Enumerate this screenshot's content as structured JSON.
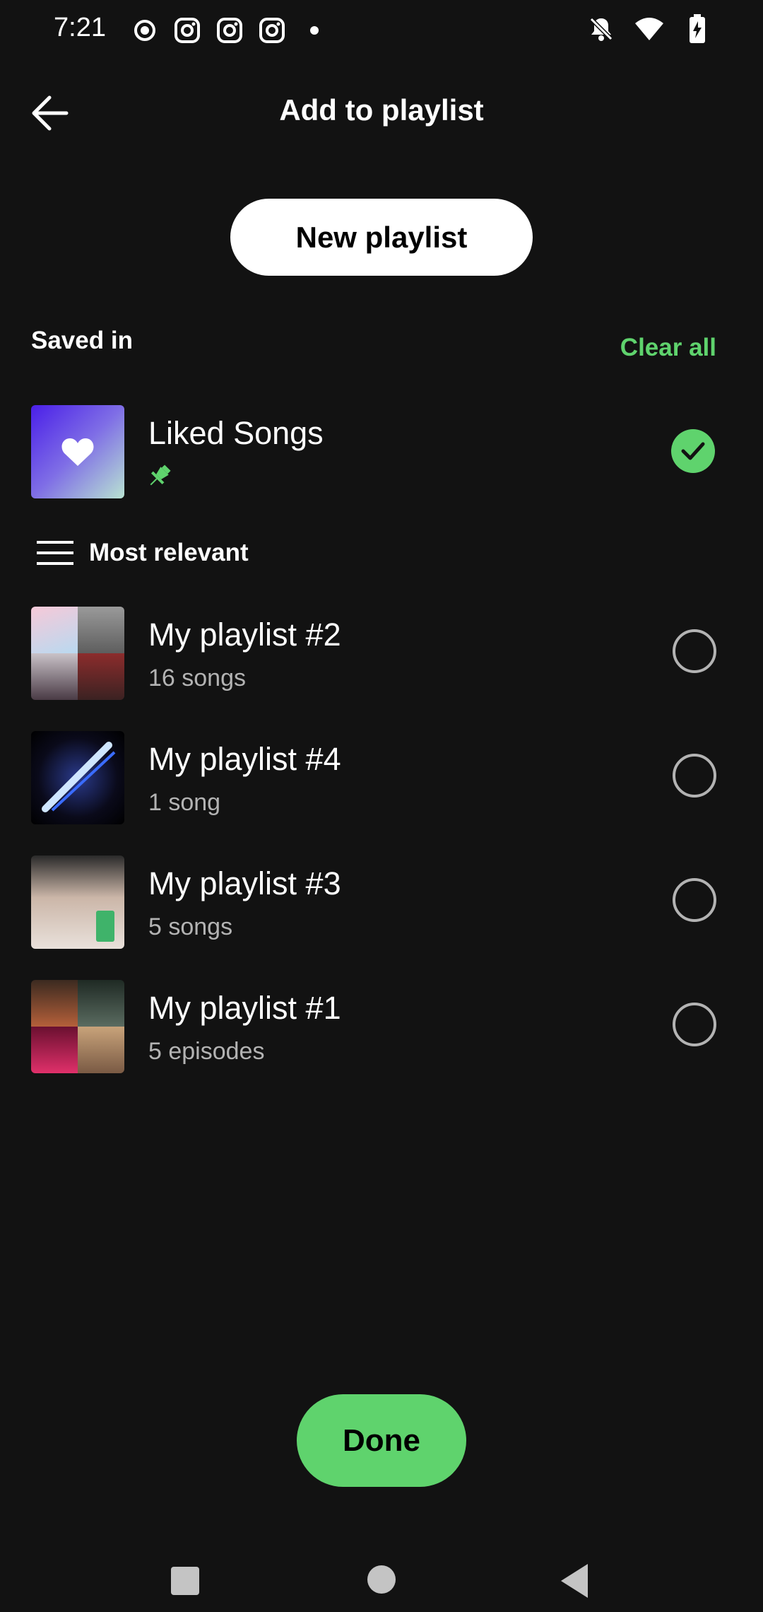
{
  "status_bar": {
    "time": "7:21",
    "left_icons": [
      "record-icon",
      "instagram-icon",
      "instagram-icon",
      "instagram-icon",
      "dot-icon"
    ],
    "right_icons": [
      "bell-off-icon",
      "wifi-icon",
      "battery-charging-icon"
    ]
  },
  "header": {
    "title": "Add to playlist",
    "back_icon": "arrow-left-icon"
  },
  "new_playlist_label": "New playlist",
  "saved_in": {
    "label": "Saved in",
    "clear_all_label": "Clear all",
    "items": [
      {
        "title": "Liked Songs",
        "pinned": true,
        "selected": true
      }
    ]
  },
  "sort": {
    "label": "Most relevant",
    "icon": "list-sort-icon"
  },
  "playlists": [
    {
      "title": "My playlist #2",
      "subtitle": "16 songs",
      "selected": false
    },
    {
      "title": "My playlist #4",
      "subtitle": "1 song",
      "selected": false
    },
    {
      "title": "My playlist #3",
      "subtitle": "5 songs",
      "selected": false
    },
    {
      "title": "My playlist #1",
      "subtitle": "5 episodes",
      "selected": false
    }
  ],
  "done_label": "Done",
  "colors": {
    "background": "#121212",
    "accent": "#5fd36d",
    "text_secondary": "#b3b3b3"
  }
}
